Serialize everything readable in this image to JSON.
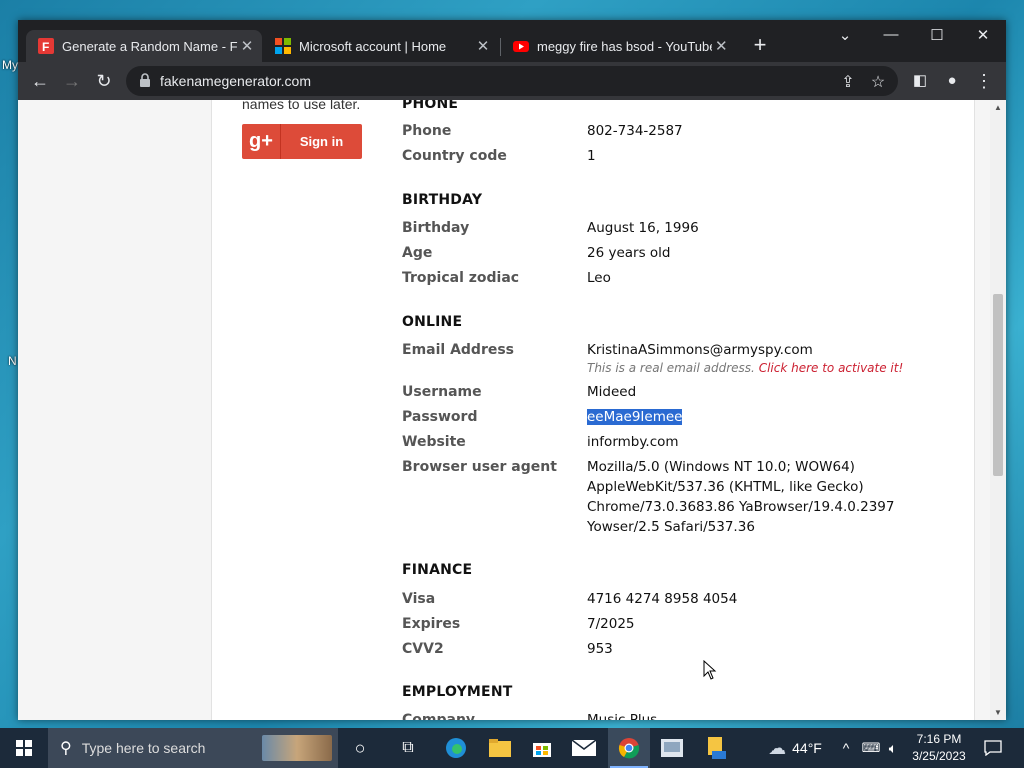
{
  "desktop": {
    "fragments": [
      "My",
      "N"
    ]
  },
  "browser": {
    "tabs": [
      {
        "title": "Generate a Random Name - Fake",
        "favicon": "fakename-favicon",
        "active": true
      },
      {
        "title": "Microsoft account | Home",
        "favicon": "microsoft-favicon",
        "active": false
      },
      {
        "title": "meggy fire has bsod - YouTube",
        "favicon": "youtube-favicon",
        "active": false
      }
    ],
    "url": "fakenamegenerator.com"
  },
  "page": {
    "sidebar_text": "names to use later.",
    "gplus_label": "Sign in",
    "phone": {
      "heading": "PHONE",
      "phone_label": "Phone",
      "phone_value": "802-734-2587",
      "country_label": "Country code",
      "country_value": "1"
    },
    "birthday": {
      "heading": "BIRTHDAY",
      "birthday_label": "Birthday",
      "birthday_value": "August 16, 1996",
      "age_label": "Age",
      "age_value": "26 years old",
      "zodiac_label": "Tropical zodiac",
      "zodiac_value": "Leo"
    },
    "online": {
      "heading": "ONLINE",
      "email_label": "Email Address",
      "email_value": "KristinaASimmons@armyspy.com",
      "email_note": "This is a real email address.",
      "email_activate": "Click here to activate it!",
      "username_label": "Username",
      "username_value": "Mideed",
      "password_label": "Password",
      "password_value": "eeMae9Iemee",
      "website_label": "Website",
      "website_value": "informby.com",
      "ua_label": "Browser user agent",
      "ua_lines": [
        "Mozilla/5.0 (Windows NT 10.0; WOW64)",
        "AppleWebKit/537.36 (KHTML, like Gecko)",
        "Chrome/73.0.3683.86 YaBrowser/19.4.0.2397",
        "Yowser/2.5 Safari/537.36"
      ]
    },
    "finance": {
      "heading": "FINANCE",
      "visa_label": "Visa",
      "visa_value": "4716 4274 8958 4054",
      "expires_label": "Expires",
      "expires_value": "7/2025",
      "cvv_label": "CVV2",
      "cvv_value": "953"
    },
    "employment": {
      "heading": "EMPLOYMENT",
      "company_label": "Company",
      "company_value": "Music Plus"
    }
  },
  "taskbar": {
    "search_placeholder": "Type here to search",
    "weather": "44°F",
    "time": "7:16 PM",
    "date": "3/25/2023"
  },
  "colors": {
    "selection": "#2a6ad2",
    "activate_link": "#cc2233",
    "gplus": "#dd4b39"
  }
}
